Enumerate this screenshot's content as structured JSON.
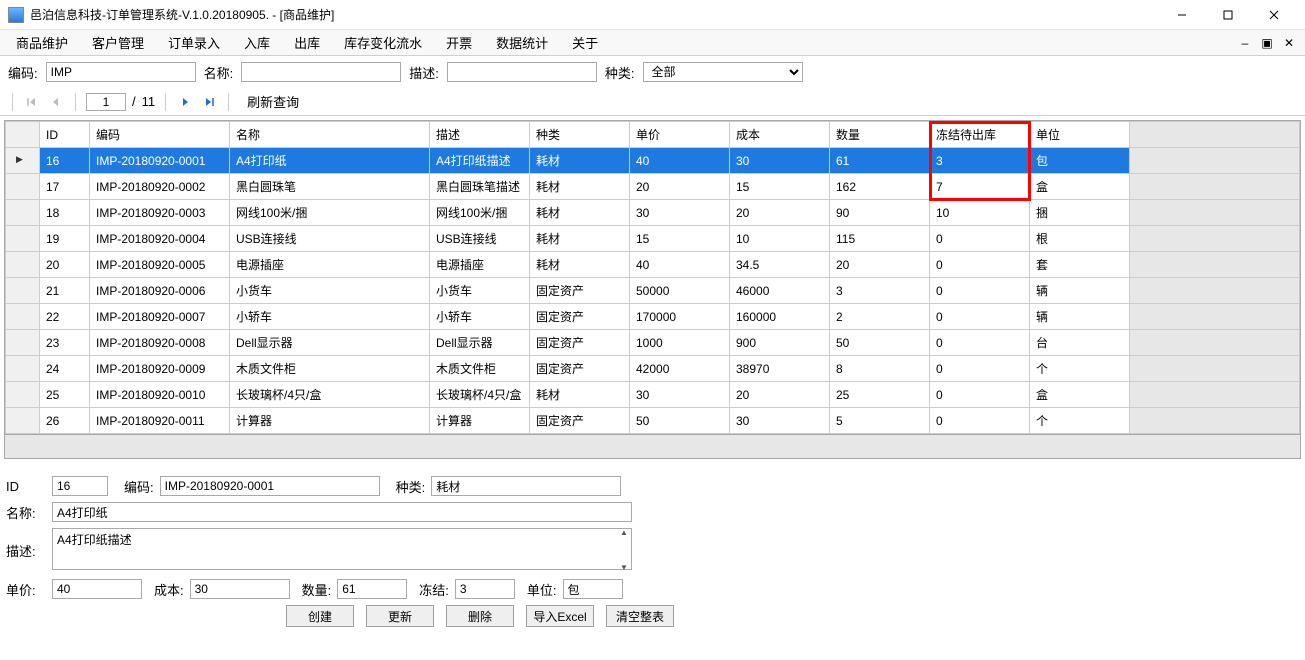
{
  "window": {
    "title": "邑泊信息科技-订单管理系统-V.1.0.20180905. - [商品维护]"
  },
  "menu": {
    "items": [
      "商品维护",
      "客户管理",
      "订单录入",
      "入库",
      "出库",
      "库存变化流水",
      "开票",
      "数据统计",
      "关于"
    ]
  },
  "filter": {
    "code_label": "编码:",
    "code_value": "IMP",
    "name_label": "名称:",
    "name_value": "",
    "desc_label": "描述:",
    "desc_value": "",
    "kind_label": "种类:",
    "kind_value": "全部"
  },
  "nav": {
    "current_page": "1",
    "total_pages": "11",
    "of": "/",
    "refresh": "刷新查询"
  },
  "grid": {
    "headers": [
      "ID",
      "编码",
      "名称",
      "描述",
      "种类",
      "单价",
      "成本",
      "数量",
      "冻结待出库",
      "单位"
    ],
    "rows": [
      {
        "id": "16",
        "code": "IMP-20180920-0001",
        "name": "A4打印纸",
        "desc": "A4打印纸描述",
        "kind": "耗材",
        "price": "40",
        "cost": "30",
        "qty": "61",
        "freeze": "3",
        "unit": "包",
        "selected": true
      },
      {
        "id": "17",
        "code": "IMP-20180920-0002",
        "name": "黑白圆珠笔",
        "desc": "黑白圆珠笔描述",
        "kind": "耗材",
        "price": "20",
        "cost": "15",
        "qty": "162",
        "freeze": "7",
        "unit": "盒",
        "selected": false
      },
      {
        "id": "18",
        "code": "IMP-20180920-0003",
        "name": "网线100米/捆",
        "desc": "网线100米/捆",
        "kind": "耗材",
        "price": "30",
        "cost": "20",
        "qty": "90",
        "freeze": "10",
        "unit": "捆",
        "selected": false
      },
      {
        "id": "19",
        "code": "IMP-20180920-0004",
        "name": "USB连接线",
        "desc": "USB连接线",
        "kind": "耗材",
        "price": "15",
        "cost": "10",
        "qty": "115",
        "freeze": "0",
        "unit": "根",
        "selected": false
      },
      {
        "id": "20",
        "code": "IMP-20180920-0005",
        "name": "电源插座",
        "desc": "电源插座",
        "kind": "耗材",
        "price": "40",
        "cost": "34.5",
        "qty": "20",
        "freeze": "0",
        "unit": "套",
        "selected": false
      },
      {
        "id": "21",
        "code": "IMP-20180920-0006",
        "name": "小货车",
        "desc": "小货车",
        "kind": "固定资产",
        "price": "50000",
        "cost": "46000",
        "qty": "3",
        "freeze": "0",
        "unit": "辆",
        "selected": false
      },
      {
        "id": "22",
        "code": "IMP-20180920-0007",
        "name": "小轿车",
        "desc": "小轿车",
        "kind": "固定资产",
        "price": "170000",
        "cost": "160000",
        "qty": "2",
        "freeze": "0",
        "unit": "辆",
        "selected": false
      },
      {
        "id": "23",
        "code": "IMP-20180920-0008",
        "name": "Dell显示器",
        "desc": "Dell显示器",
        "kind": "固定资产",
        "price": "1000",
        "cost": "900",
        "qty": "50",
        "freeze": "0",
        "unit": "台",
        "selected": false
      },
      {
        "id": "24",
        "code": "IMP-20180920-0009",
        "name": "木质文件柜",
        "desc": "木质文件柜",
        "kind": "固定资产",
        "price": "42000",
        "cost": "38970",
        "qty": "8",
        "freeze": "0",
        "unit": "个",
        "selected": false
      },
      {
        "id": "25",
        "code": "IMP-20180920-0010",
        "name": "长玻璃杯/4只/盒",
        "desc": "长玻璃杯/4只/盒",
        "kind": "耗材",
        "price": "30",
        "cost": "20",
        "qty": "25",
        "freeze": "0",
        "unit": "盒",
        "selected": false
      },
      {
        "id": "26",
        "code": "IMP-20180920-0011",
        "name": "计算器",
        "desc": "计算器",
        "kind": "固定资产",
        "price": "50",
        "cost": "30",
        "qty": "5",
        "freeze": "0",
        "unit": "个",
        "selected": false
      }
    ]
  },
  "details": {
    "id_label": "ID",
    "id_value": "16",
    "code_label": "编码:",
    "code_value": "IMP-20180920-0001",
    "kind_label": "种类:",
    "kind_value": "耗材",
    "name_label": "名称:",
    "name_value": "A4打印纸",
    "desc_label": "描述:",
    "desc_value": "A4打印纸描述",
    "price_label": "单价:",
    "price_value": "40",
    "cost_label": "成本:",
    "cost_value": "30",
    "qty_label": "数量:",
    "qty_value": "61",
    "freeze_label": "冻结:",
    "freeze_value": "3",
    "unit_label": "单位:",
    "unit_value": "包",
    "buttons": {
      "create": "创建",
      "update": "更新",
      "delete": "删除",
      "import": "导入Excel",
      "clear": "清空整表"
    }
  }
}
